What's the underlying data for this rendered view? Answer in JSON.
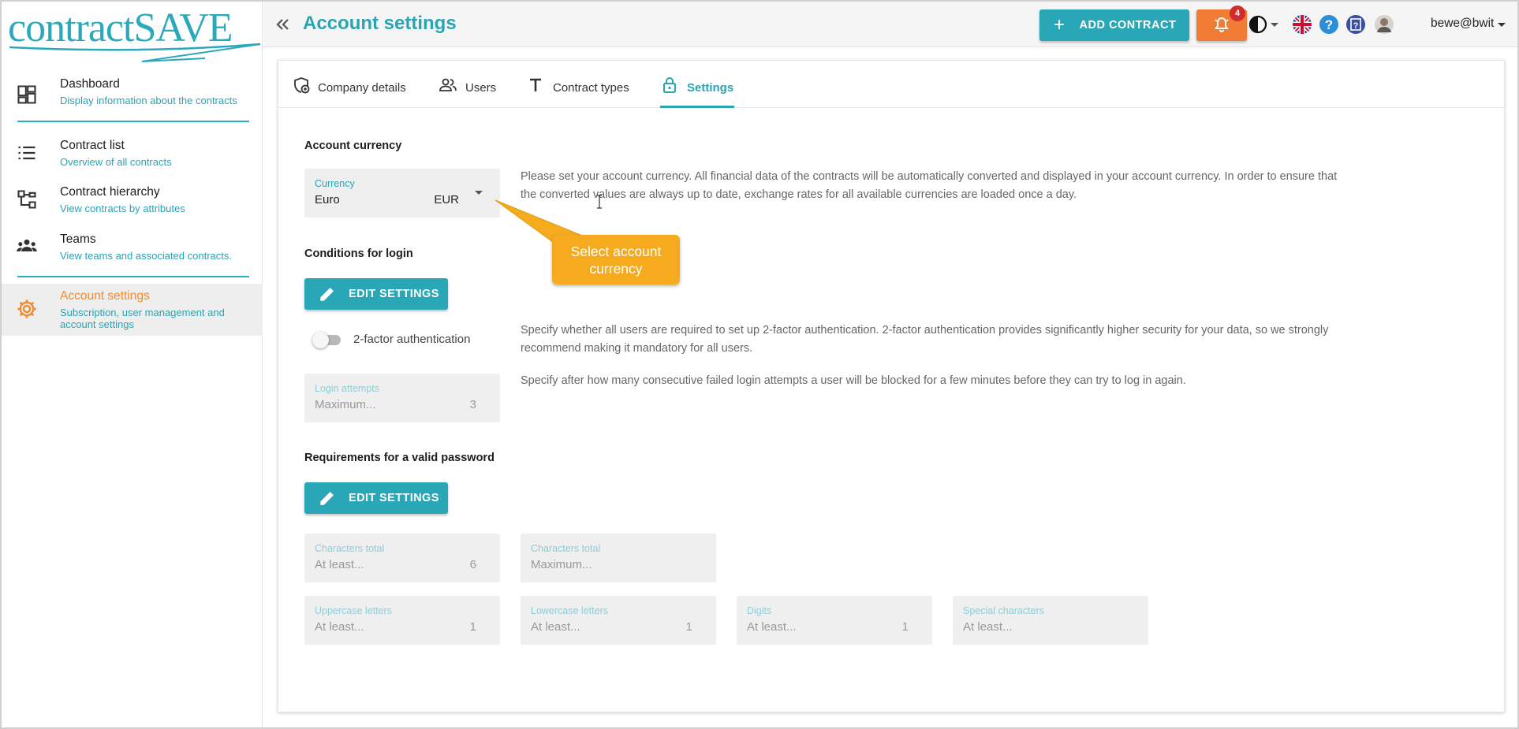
{
  "app": {
    "logo_text": "contractSAVE",
    "accent_color": "#2aa3b3",
    "orange_color": "#f07c36"
  },
  "sidebar": {
    "items": [
      {
        "title": "Dashboard",
        "subtitle": "Display information about the contracts",
        "icon": "dashboard-icon"
      },
      {
        "title": "Contract list",
        "subtitle": "Overview of all contracts",
        "icon": "list-icon"
      },
      {
        "title": "Contract hierarchy",
        "subtitle": "View contracts by attributes",
        "icon": "hierarchy-icon"
      },
      {
        "title": "Teams",
        "subtitle": "View teams and associated contracts.",
        "icon": "teams-icon"
      },
      {
        "title": "Account settings",
        "subtitle_line1": "Subscription, user management and",
        "subtitle_line2": "account settings",
        "icon": "gear-icon",
        "active": true
      }
    ]
  },
  "header": {
    "title": "Account settings",
    "add_contract_label": "ADD CONTRACT",
    "notification_count": "4",
    "user_name": "bewe@bwit"
  },
  "tabs": [
    {
      "label": "Company details",
      "icon": "company-icon"
    },
    {
      "label": "Users",
      "icon": "users-icon"
    },
    {
      "label": "Contract types",
      "icon": "text-icon"
    },
    {
      "label": "Settings",
      "icon": "lock-icon",
      "active": true
    }
  ],
  "settings": {
    "currency_section": {
      "title": "Account currency",
      "field_label": "Currency",
      "value": "Euro",
      "code": "EUR",
      "description_line1": "Please set your account currency. All financial data of the contracts will be automatically converted and displayed in your account currency. In order to ensure that",
      "description_line2": "the converted values are always up to date, exchange rates for all available currencies are loaded once a day."
    },
    "login_section": {
      "title": "Conditions for login",
      "edit_label": "EDIT SETTINGS",
      "two_factor_label": "2-factor authentication",
      "two_factor_enabled": false,
      "two_factor_desc_line1": "Specify whether all users are required to set up 2-factor authentication. 2-factor authentication provides significantly higher security for your data, so we strongly",
      "two_factor_desc_line2": "recommend making it mandatory for all users.",
      "attempts_label": "Login attempts",
      "attempts_placeholder": "Maximum...",
      "attempts_value": "3",
      "attempts_desc": "Specify after how many consecutive failed login attempts a user will be blocked for a few minutes before they can try to log in again."
    },
    "password_section": {
      "title": "Requirements for a valid password",
      "edit_label": "EDIT SETTINGS",
      "fields": [
        {
          "label": "Characters total",
          "placeholder": "At least...",
          "value": "6"
        },
        {
          "label": "Characters total",
          "placeholder": "Maximum...",
          "value": ""
        },
        {
          "label": "Uppercase letters",
          "placeholder": "At least...",
          "value": "1"
        },
        {
          "label": "Lowercase letters",
          "placeholder": "At least...",
          "value": "1"
        },
        {
          "label": "Digits",
          "placeholder": "At least...",
          "value": "1"
        },
        {
          "label": "Special characters",
          "placeholder": "At least...",
          "value": ""
        }
      ]
    }
  },
  "callout": {
    "line1": "Select account",
    "line2": "currency",
    "color": "#f6ab1e"
  }
}
